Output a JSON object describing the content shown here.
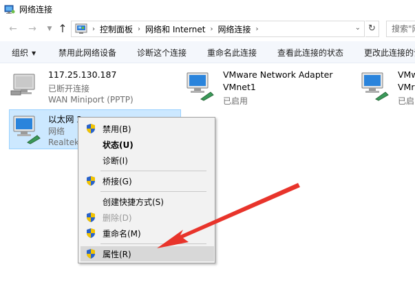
{
  "window": {
    "title": "网络连接"
  },
  "nav": {
    "breadcrumbs": [
      "控制面板",
      "网络和 Internet",
      "网络连接"
    ],
    "search_placeholder": "搜索\"网络"
  },
  "toolbar": {
    "organize": "组织",
    "disable_device": "禁用此网络设备",
    "diagnose": "诊断这个连接",
    "rename": "重命名此连接",
    "view_status": "查看此连接的状态",
    "change_settings": "更改此连接的设"
  },
  "connections": [
    {
      "name": "117.25.130.187",
      "status": "已断开连接",
      "device": "WAN Miniport (PPTP)"
    },
    {
      "name": "VMware Network Adapter",
      "name2": "VMnet1",
      "status": "已启用"
    },
    {
      "name": "VMw",
      "name2": "VMr",
      "status": "已启"
    },
    {
      "name": "以太网 2",
      "status": "网络",
      "device": "Realtek"
    }
  ],
  "context_menu": {
    "items": [
      {
        "label": "禁用(B)",
        "shield": true
      },
      {
        "label": "状态(U)",
        "bold": true
      },
      {
        "label": "诊断(I)"
      },
      {
        "label": "桥接(G)",
        "shield": true
      },
      {
        "label": "创建快捷方式(S)"
      },
      {
        "label": "删除(D)",
        "shield": true,
        "disabled": true
      },
      {
        "label": "重命名(M)",
        "shield": true
      },
      {
        "label": "属性(R)",
        "shield": true,
        "highlighted": true
      }
    ]
  },
  "colors": {
    "selection_bg": "#cce8ff",
    "arrow": "#e8342b",
    "command_bar": "#f4f7fc"
  }
}
